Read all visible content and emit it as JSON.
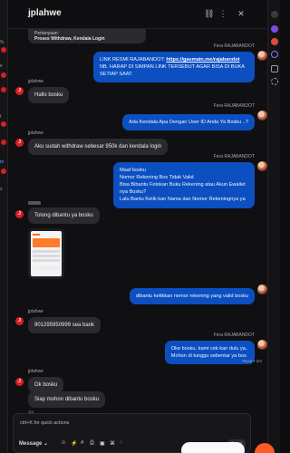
{
  "header": {
    "title": "jplahwe"
  },
  "left_strip": {
    "items": [
      {
        "label": "7",
        "top": 0
      },
      {
        "label": "5",
        "top": 1
      }
    ]
  },
  "top_quote": {
    "line1": "Pertanyaan:",
    "line2": "Proses Withdraw, Kendala Login"
  },
  "messages": {
    "m1": {
      "sender": "",
      "text_a": "LINK RESMI RAJABANDOT: ",
      "link": "https://gasmain.me/rajabandot",
      "text_b": " NB. HARAP DI SIMPAN LINK TERSEBUT AGAR BISA DI BUKA SETIAP SAAT."
    },
    "m1_sender": "Fera RAJABANDOT",
    "m2_sender": "jplahwe",
    "m2": "Hallo bosku",
    "m3_sender": "Fera RAJABANDOT",
    "m3": "Ada Kendala Apa Dengan User ID Anda Ya Bosku ..?",
    "m4_sender": "jplahwe",
    "m4": "Aku sudah withdraw sebesar 950k dan kendala login",
    "m5_sender": "Fera RAJABANDOT",
    "m5_lines": [
      "Maaf bosku",
      "Nomor Rekening Bos Tidak Valid",
      "Bisa Bibantu Fotokan Buku Rekening atau Akun Ewallet nya Bosku?",
      "Lalu Bantu Ketik kan Nama dan Nomor Rekeningnya ya"
    ],
    "m6_sender": "",
    "m6": "Tolong dibantu ya bosku",
    "m7": "dibantu ketikkan nomor rekening yang valid bosku",
    "m8_sender": "jplahwe",
    "m8": "901295950999 sea bank",
    "m9_sender": "Fera RAJABANDOT",
    "m9_lines": [
      "Oke bosku, kami cek kan dulu ya..",
      "Mohon di tunggu sebentar ya bos"
    ],
    "read": "Read • 1m",
    "m10_sender": "jplahwe",
    "m10": "Ok bosku",
    "m11": "Siap mohon dibantu bosku",
    "m11_time": "1m"
  },
  "composer": {
    "placeholder": "ctrl+K for quick actions",
    "message_label": "Message",
    "send_label": "Send"
  },
  "colors": {
    "outgoing": "#0c4fc0",
    "incoming": "#2a2a2f",
    "avatar": "#d62027",
    "accent": "#ff5a26"
  }
}
